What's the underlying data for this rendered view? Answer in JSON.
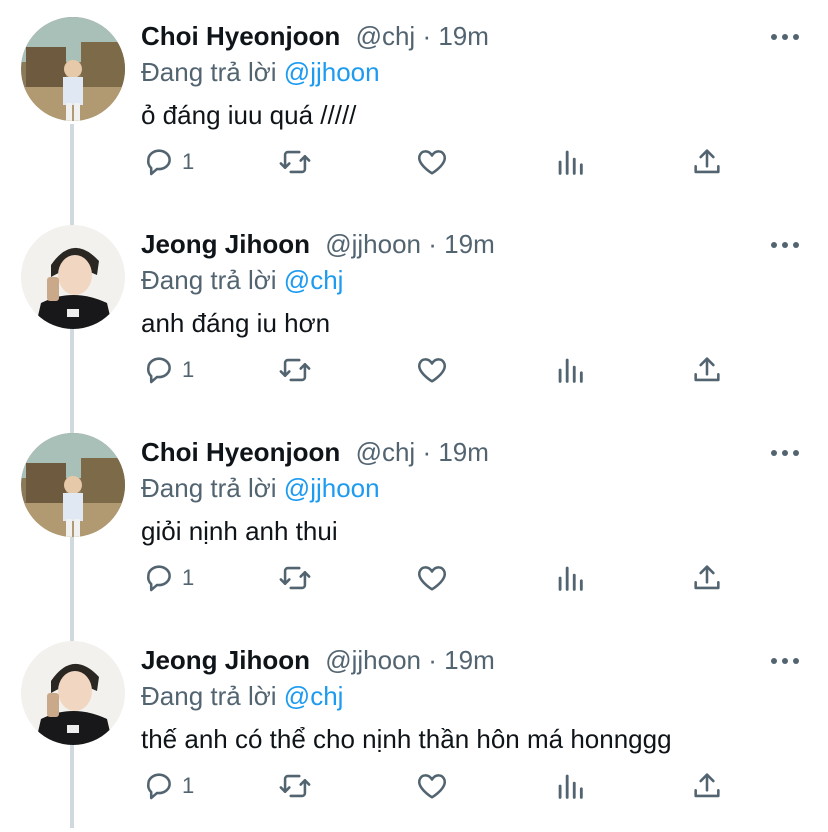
{
  "tweets": [
    {
      "name": "Choi Hyeonjoon",
      "handle": "@chj",
      "dot": "·",
      "time": "19m",
      "reply_prefix": "Đang trả lời",
      "reply_to": "@jjhoon",
      "text": "ỏ đáng iuu quá /////",
      "reply_count": "1",
      "avatar": "avatar-choi"
    },
    {
      "name": "Jeong Jihoon",
      "handle": "@jjhoon",
      "dot": "·",
      "time": "19m",
      "reply_prefix": "Đang trả lời",
      "reply_to": "@chj",
      "text": "anh đáng iu hơn",
      "reply_count": "1",
      "avatar": "avatar-jeong"
    },
    {
      "name": "Choi Hyeonjoon",
      "handle": "@chj",
      "dot": "·",
      "time": "19m",
      "reply_prefix": "Đang trả lời",
      "reply_to": "@jjhoon",
      "text": "giỏi nịnh anh thui",
      "reply_count": "1",
      "avatar": "avatar-choi"
    },
    {
      "name": "Jeong Jihoon",
      "handle": "@jjhoon",
      "dot": "·",
      "time": "19m",
      "reply_prefix": "Đang trả lời",
      "reply_to": "@chj",
      "text": "thế anh có thể cho nịnh thần hôn má honnggg",
      "reply_count": "1",
      "avatar": "avatar-jeong"
    }
  ],
  "icons": {
    "reply": "reply-icon",
    "retweet": "retweet-icon",
    "like": "heart-icon",
    "views": "analytics-icon",
    "share": "share-icon",
    "more": "more-icon"
  },
  "colors": {
    "text": "#0f1419",
    "secondary": "#536471",
    "mention": "#1d9bf0",
    "thread_line": "#cfd9de"
  }
}
